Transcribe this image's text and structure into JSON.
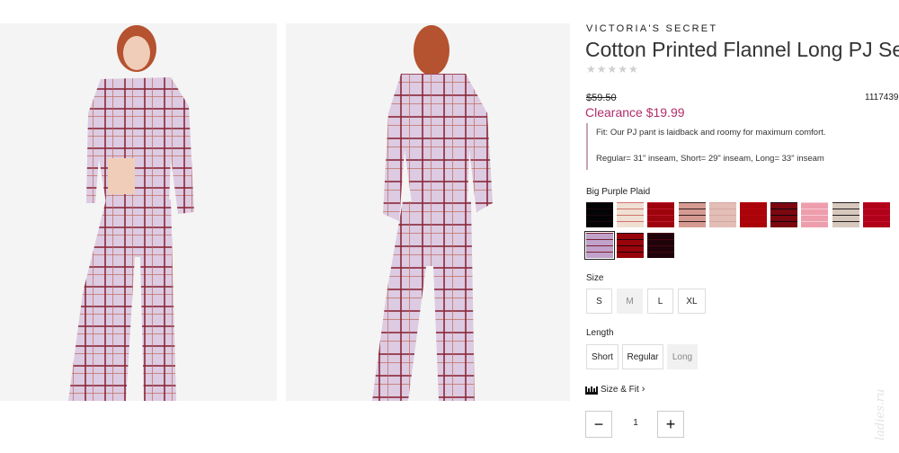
{
  "product": {
    "brand": "VICTORIA'S SECRET",
    "title": "Cotton Printed Flannel Long PJ Set",
    "rating_stars": "★★★★★",
    "original_price": "$59.50",
    "sale_price": "Clearance $19.99",
    "sku": "1117439",
    "fit_note": "Fit: Our PJ pant is laidback and roomy for maximum comfort.",
    "inseam_note": "Regular= 31\" inseam, Short= 29\" inseam, Long= 33\" inseam"
  },
  "images": [
    {
      "name": "model-front-photo"
    },
    {
      "name": "model-back-photo"
    }
  ],
  "color": {
    "selected_label": "Big Purple Plaid",
    "swatches": [
      {
        "name": "black-floral",
        "color": "#1e1b22",
        "accent": "#d14a6f"
      },
      {
        "name": "cream-dot",
        "color": "#f7efe8",
        "accent": "#d97a7a"
      },
      {
        "name": "red-pattern",
        "color": "#c8213a",
        "accent": "#f2b1bd"
      },
      {
        "name": "pink-gingham",
        "color": "#e9c7c1",
        "accent": "#3a2a2a"
      },
      {
        "name": "blush-print",
        "color": "#f0dcd8",
        "accent": "#e4c4c0"
      },
      {
        "name": "red-solid",
        "color": "#d01a32",
        "accent": "#e23347"
      },
      {
        "name": "navy-red-plaid",
        "color": "#b22a3e",
        "accent": "#1f2a44"
      },
      {
        "name": "pink-stripe",
        "color": "#f6c9d2",
        "accent": "#ffffff"
      },
      {
        "name": "black-white-check",
        "color": "#eae2dc",
        "accent": "#2a2325"
      },
      {
        "name": "magenta-plaid",
        "color": "#d4184f",
        "accent": "#f07a9b"
      },
      {
        "name": "big-purple-plaid",
        "color": "#ddcbe3",
        "accent": "#8c2a3a"
      },
      {
        "name": "red-black-plaid",
        "color": "#c51e36",
        "accent": "#2a1a1e"
      },
      {
        "name": "wine-plaid",
        "color": "#5a1a33",
        "accent": "#c73b5d"
      }
    ]
  },
  "size": {
    "label": "Size",
    "options": [
      {
        "label": "S",
        "available": true
      },
      {
        "label": "M",
        "available": false
      },
      {
        "label": "L",
        "available": true
      },
      {
        "label": "XL",
        "available": true
      }
    ]
  },
  "length": {
    "label": "Length",
    "options": [
      {
        "label": "Short",
        "available": true
      },
      {
        "label": "Regular",
        "available": true
      },
      {
        "label": "Long",
        "available": false
      }
    ]
  },
  "size_fit_link": "Size & Fit",
  "quantity": {
    "value": "1",
    "decrement_label": "−",
    "increment_label": "+"
  },
  "watermark": "ladies.ru"
}
